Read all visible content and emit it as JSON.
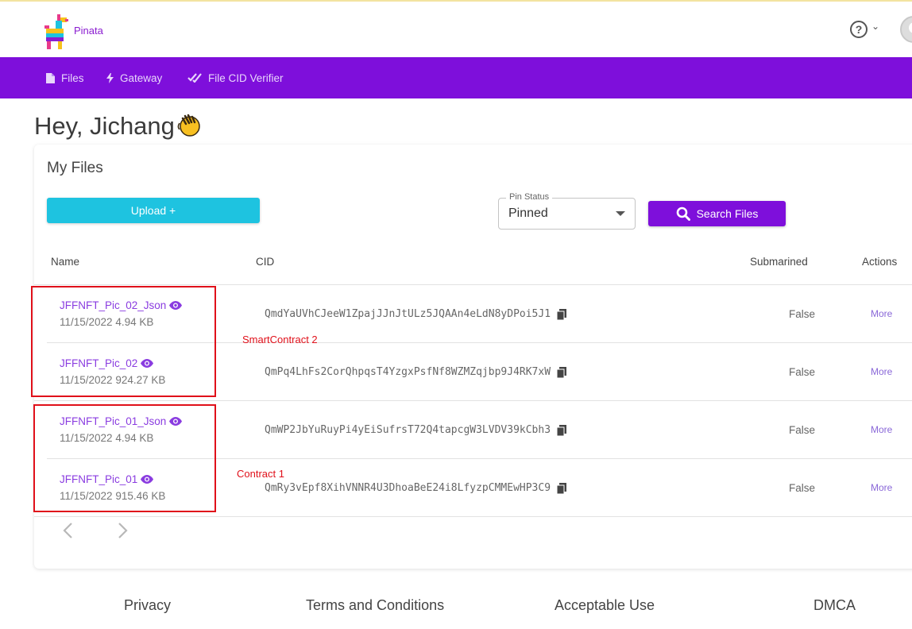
{
  "app": {
    "brand": "Pinata"
  },
  "header": {
    "help_icon": "question-circle-icon",
    "help_caret_icon": "chevron-down-icon",
    "avatar_icon": "user-avatar-icon"
  },
  "nav": {
    "items": [
      {
        "label": "Files",
        "icon": "file-icon"
      },
      {
        "label": "Gateway",
        "icon": "bolt-icon"
      },
      {
        "label": "File CID Verifier",
        "icon": "double-check-icon"
      }
    ],
    "background": "#7e0fdb"
  },
  "greeting": {
    "text": "Hey, Jichang",
    "emoji": "waving-hand-icon"
  },
  "files": {
    "title": "My Files",
    "upload_label": "Upload +",
    "pin_status": {
      "legend": "Pin Status",
      "value": "Pinned"
    },
    "search_label": "Search Files",
    "columns": [
      "Name",
      "CID",
      "Submarined",
      "Actions"
    ],
    "rows": [
      {
        "name": "JFFNFT_Pic_02_Json",
        "meta": "11/15/2022 4.94 KB",
        "cid": "QmdYaUVhCJeeW1ZpajJJnJtULz5JQAAn4eLdN8yDPoi5J1",
        "submarined": "False",
        "action": "More"
      },
      {
        "name": "JFFNFT_Pic_02",
        "meta": "11/15/2022 924.27 KB",
        "cid": "QmPq4LhFs2CorQhpqsT4YzgxPsfNf8WZMZqjbp9J4RK7xW",
        "submarined": "False",
        "action": "More"
      },
      {
        "name": "JFFNFT_Pic_01_Json",
        "meta": "11/15/2022 4.94 KB",
        "cid": "QmWP2JbYuRuyPi4yEiSufrsT72Q4tapcgW3LVDV39kCbh3",
        "submarined": "False",
        "action": "More"
      },
      {
        "name": "JFFNFT_Pic_01",
        "meta": "11/15/2022 915.46 KB",
        "cid": "QmRy3vEpf8XihVNNR4U3DhoaBeE24i8LfyzpCMMEwHP3C9",
        "submarined": "False",
        "action": "More"
      }
    ]
  },
  "annotations": [
    {
      "label": "SmartContract 2",
      "color": "#e0101a"
    },
    {
      "label": "Contract 1",
      "color": "#e0101a"
    }
  ],
  "footer": {
    "links": [
      "Privacy",
      "Terms and Conditions",
      "Acceptable Use",
      "DMCA"
    ]
  }
}
